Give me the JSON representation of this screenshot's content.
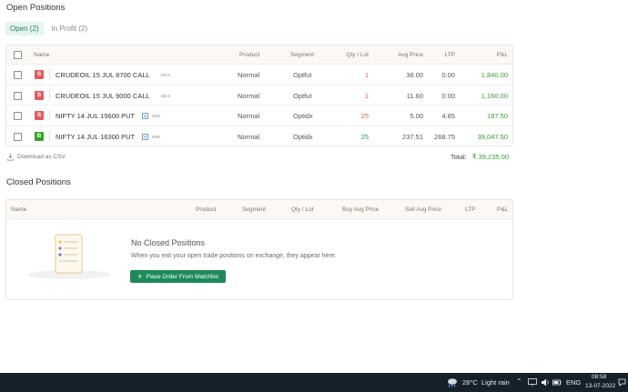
{
  "open_positions": {
    "title": "Open Positions",
    "tabs": [
      {
        "label": "Open (2)",
        "active": true
      },
      {
        "label": "In Profit (2)",
        "active": false
      }
    ],
    "columns": {
      "name": "Name",
      "product": "Product",
      "segment": "Segment",
      "qty": "Qty / Lot",
      "avg": "Avg Price",
      "ltp": "LTP",
      "pl": "P&L"
    },
    "rows": [
      {
        "side": "S",
        "instrument": "CRUDEOIL 15 JUL 8700 CALL",
        "exchange": "MCX",
        "watch": false,
        "product": "Normal",
        "segment": "Optfut",
        "qty": "1",
        "avg": "38.00",
        "ltp": "0.00",
        "pl": "1,840.00"
      },
      {
        "side": "S",
        "instrument": "CRUDEOIL 15 JUL 9000 CALL",
        "exchange": "MCX",
        "watch": false,
        "product": "Normal",
        "segment": "Optfut",
        "qty": "1",
        "avg": "11.60",
        "ltp": "0.00",
        "pl": "1,160.00"
      },
      {
        "side": "S",
        "instrument": "NIFTY 14 JUL 15600 PUT",
        "exchange": "NSE",
        "watch": true,
        "product": "Normal",
        "segment": "Optidx",
        "qty": "25",
        "avg": "5.00",
        "ltp": "4.85",
        "pl": "187.50"
      },
      {
        "side": "B",
        "instrument": "NIFTY 14 JUL 16300 PUT",
        "exchange": "NSE",
        "watch": true,
        "product": "Normal",
        "segment": "Optidx",
        "qty": "25",
        "avg": "237.51",
        "ltp": "268.75",
        "pl": "39,047.50"
      }
    ],
    "download_label": "Download as CSV",
    "total_label": "Total:",
    "total_value": "₹ 39,235.00"
  },
  "closed_positions": {
    "title": "Closed Positions",
    "columns": {
      "name": "Name",
      "product": "Product",
      "segment": "Segment",
      "qty": "Qty / Lot",
      "buy_avg": "Buy Avg Price",
      "sell_avg": "Sell Avg Price",
      "ltp": "LTP",
      "pl": "P&L"
    },
    "empty_title": "No Closed Positions",
    "empty_text": "When you exit your open trade positions on exchange, they appear here.",
    "button_label": "Place Order From Watchlist"
  },
  "taskbar": {
    "temperature": "28°C",
    "weather": "Light rain",
    "language": "ENG",
    "time": "08:58",
    "date": "13-07-2022"
  },
  "colors": {
    "accent": "#1e8a5a",
    "profit": "#3a9a33",
    "loss": "#e15d5d",
    "buy": "#36a324",
    "sell": "#e15d5d"
  }
}
